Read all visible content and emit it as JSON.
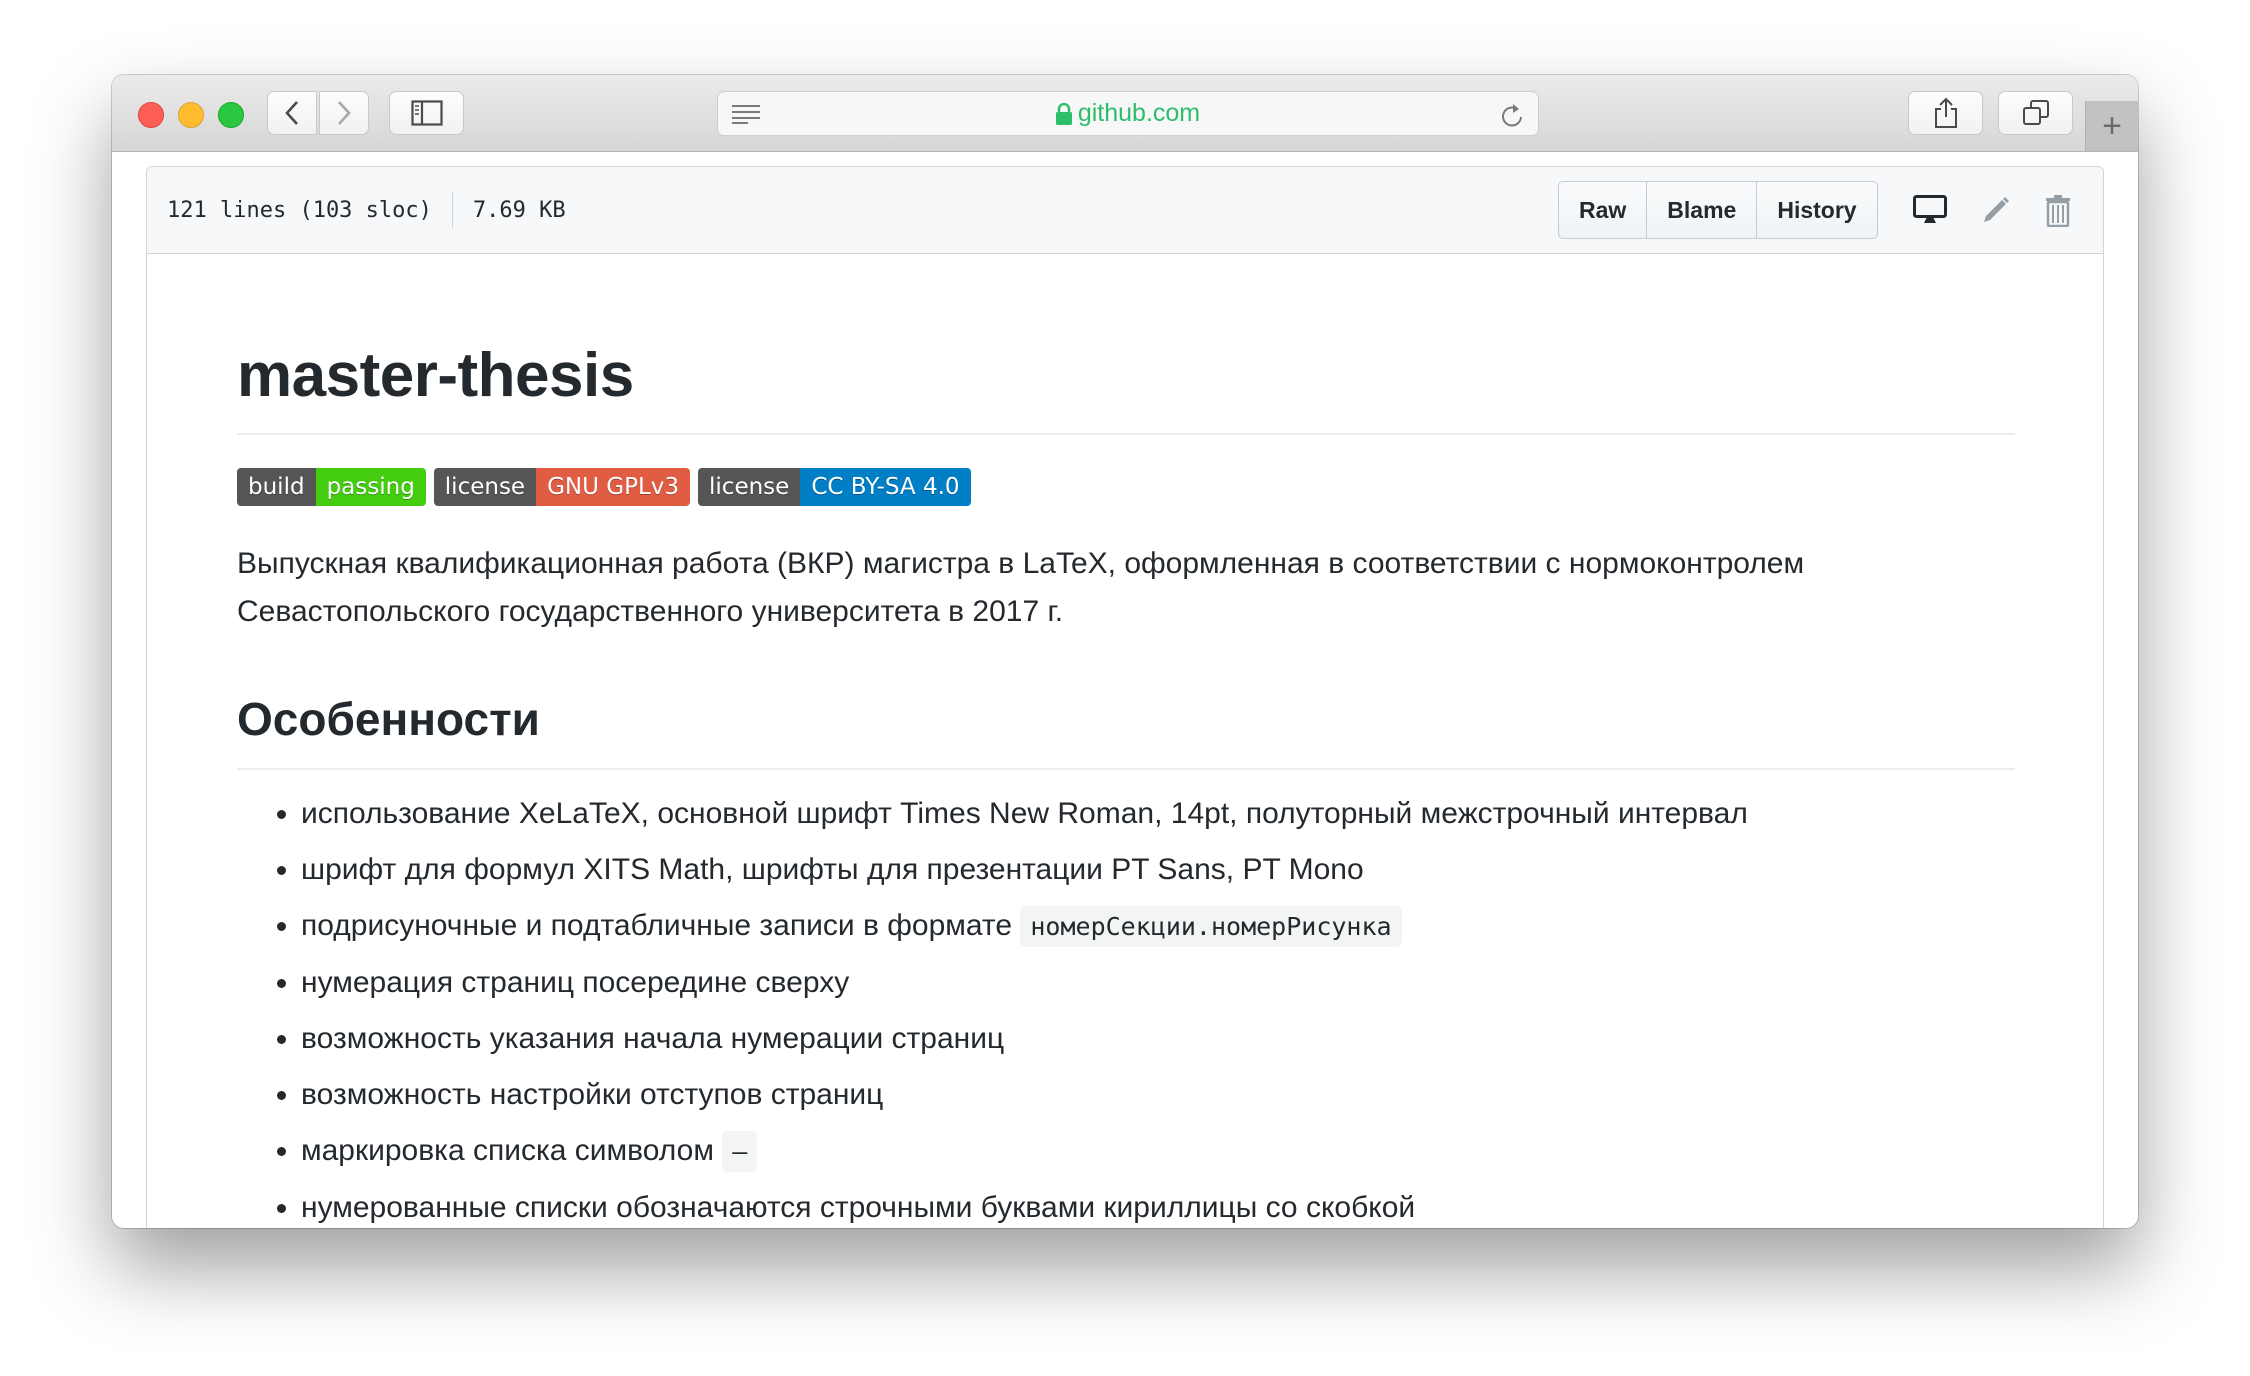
{
  "browser": {
    "url": "github.com",
    "buttons": {
      "back": "back",
      "forward": "forward",
      "sidebar": "sidebar",
      "share": "share",
      "tabs": "tabs",
      "new_tab": "+"
    }
  },
  "file_header": {
    "lines": "121 lines (103 sloc)",
    "size": "7.69 KB",
    "buttons": [
      "Raw",
      "Blame",
      "History"
    ]
  },
  "readme": {
    "title": "master-thesis",
    "badges": [
      {
        "label": "build",
        "value": "passing",
        "color": "#4c1"
      },
      {
        "label": "license",
        "value": "GNU GPLv3",
        "color": "#e05d44"
      },
      {
        "label": "license",
        "value": "CC BY-SA 4.0",
        "color": "#007ec6"
      }
    ],
    "description": "Выпускная квалификационная работа (ВКР) магистра в LaTeX, оформленная в соответствии с нормоконтролем Севастопольского государственного университета в 2017 г.",
    "features_heading": "Особенности",
    "features": [
      {
        "text": "использование XeLaTeX, основной шрифт Times New Roman, 14pt, полуторный межстрочный интервал"
      },
      {
        "text": "шрифт для формул XITS Math, шрифты для презентации PT Sans, PT Mono"
      },
      {
        "text": "подрисуночные и подтабличные записи в формате ",
        "code": "номерСекции.номерРисунка"
      },
      {
        "text": "нумерация страниц посередине сверху"
      },
      {
        "text": "возможность указания начала нумерации страниц"
      },
      {
        "text": "возможность настройки отступов страниц"
      },
      {
        "text": "маркировка списка символом ",
        "code": "–"
      },
      {
        "text": "нумерованные списки обозначаются строчными буквами кириллицы со скобкой"
      }
    ]
  }
}
